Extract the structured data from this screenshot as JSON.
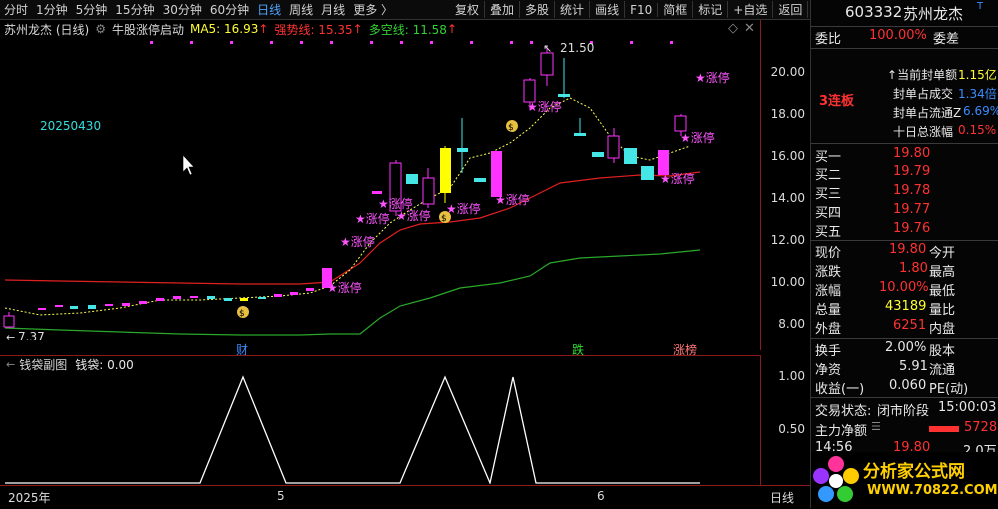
{
  "toolbar": {
    "periods": [
      "分时",
      "1分钟",
      "5分钟",
      "15分钟",
      "30分钟",
      "60分钟",
      "日线",
      "周线",
      "月线",
      "更多 〉"
    ],
    "active_period": "日线",
    "actions": [
      "复权",
      "叠加",
      "多股",
      "统计",
      "画线",
      "F10",
      "简框",
      "标记",
      "+自选",
      "返回"
    ]
  },
  "legend": {
    "stock": "苏州龙杰 (日线)",
    "indicator": "牛股涨停启动",
    "ma5": "MA5: 16.93",
    "strong_line": "强势线: 15.35",
    "bull_bear": "多空线: 11.58"
  },
  "chart": {
    "date_label": "20250430",
    "high_label": "21.50",
    "low_label": "7.37",
    "y_ticks": [
      "20.00",
      "18.00",
      "16.00",
      "14.00",
      "12.00",
      "10.00",
      "8.00"
    ],
    "limit_up_label": "涨停",
    "markers": {
      "cai": "财",
      "die": "跌",
      "zhangbang": "涨榜"
    }
  },
  "sub_chart": {
    "title": "钱袋副图",
    "value_text": "钱袋: 0.00",
    "y_ticks": [
      "1.00",
      "0.50"
    ]
  },
  "date_axis": {
    "labels": [
      "2025年",
      "5",
      "6"
    ],
    "right_label": "日线"
  },
  "chart_data": {
    "type": "line",
    "title": "",
    "series": [
      {
        "name": "钱袋",
        "values": [
          0,
          0,
          1,
          0,
          0,
          1,
          0,
          1,
          0,
          0
        ]
      }
    ]
  },
  "side": {
    "code": "603332",
    "name": "苏州龙杰",
    "weibi_label": "委比",
    "weibi_value": "100.00%",
    "weicha_label": "委差",
    "streak": "3连板",
    "seal_rows": [
      {
        "label": "当前封单额",
        "value": "1.15亿"
      },
      {
        "label": "封单占成交",
        "value": "1.34倍"
      },
      {
        "label": "封单占流通Z",
        "value": "6.69%"
      },
      {
        "label": "十日总涨幅",
        "value": "0.15%"
      }
    ],
    "buy_rows": [
      {
        "label": "买一",
        "value": "19.80"
      },
      {
        "label": "买二",
        "value": "19.79"
      },
      {
        "label": "买三",
        "value": "19.78"
      },
      {
        "label": "买四",
        "value": "19.77"
      },
      {
        "label": "买五",
        "value": "19.76"
      }
    ],
    "quote_rows": [
      {
        "l1": "现价",
        "v1": "19.80",
        "l2": "今开"
      },
      {
        "l1": "涨跌",
        "v1": "1.80",
        "l2": "最高"
      },
      {
        "l1": "涨幅",
        "v1": "10.00%",
        "l2": "最低"
      },
      {
        "l1": "总量",
        "v1": "43189",
        "l2": "量比"
      },
      {
        "l1": "外盘",
        "v1": "6251",
        "l2": "内盘"
      }
    ],
    "stat_rows": [
      {
        "l1": "换手",
        "v1": "2.00%",
        "l2": "股本"
      },
      {
        "l1": "净资",
        "v1": "5.91",
        "l2": "流通"
      },
      {
        "l1": "收益(一)",
        "v1": "0.060",
        "l2": "PE(动)"
      }
    ],
    "trade_state_label": "交易状态:",
    "trade_state_value": "闭市阶段",
    "trade_time": "15:00:03",
    "main_net_label": "主力净额",
    "main_net_value": "5728",
    "last_tick_time": "14:56",
    "last_tick_price": "19.80",
    "last_tick_vol": "2.0万"
  },
  "watermark": {
    "text1": "分析家公式网",
    "text2": "WWW.70822.COM"
  }
}
